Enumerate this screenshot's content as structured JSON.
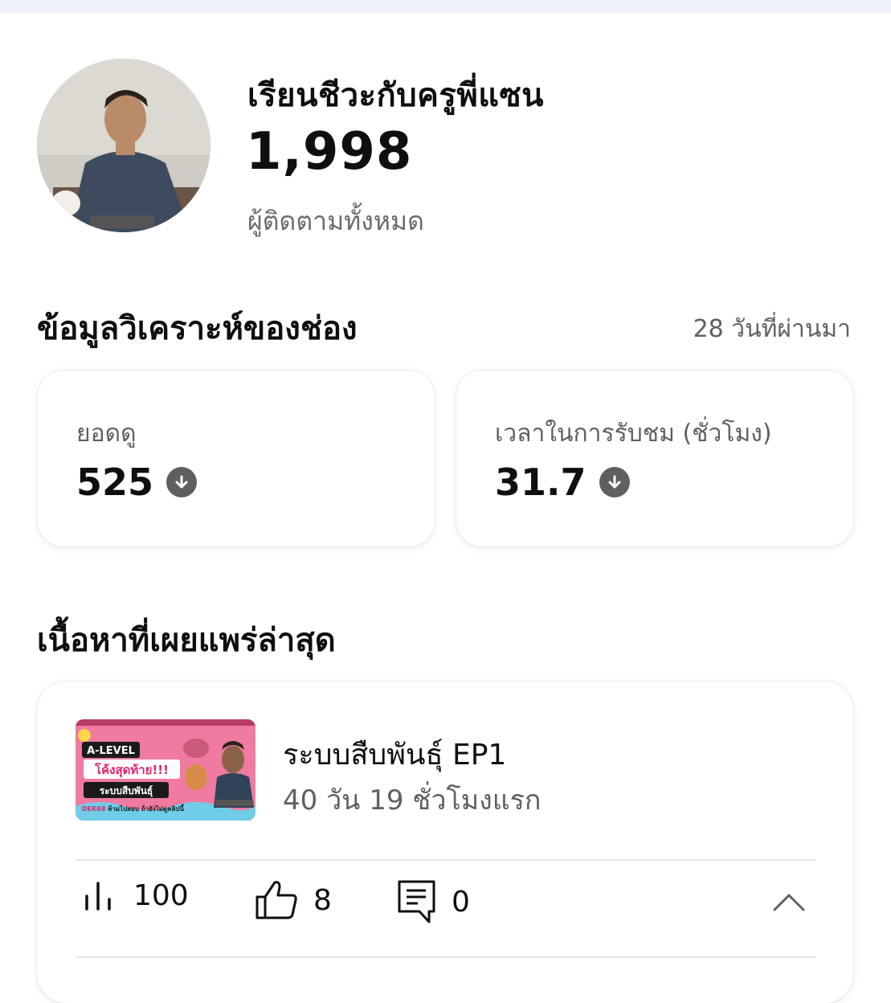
{
  "channel": {
    "name": "เรียนชีวะกับครูพี่แซน",
    "subscriber_count": "1,998",
    "subscriber_label": "ผู้ติดตามทั้งหมด"
  },
  "analytics": {
    "title": "ข้อมูลวิเคราะห์ของช่อง",
    "period": "28 วันที่ผ่านมา",
    "views": {
      "label": "ยอดดู",
      "value": "525",
      "trend_icon": "arrow-down-circle-icon"
    },
    "watch_time": {
      "label": "เวลาในการรับชม (ชั่วโมง)",
      "value": "31.7",
      "trend_icon": "arrow-down-circle-icon"
    }
  },
  "latest_content": {
    "title": "เนื้อหาที่เผยแพร่ล่าสุด",
    "video": {
      "title": "ระบบสืบพันธุ์ EP1",
      "age": "40 วัน 19 ชั่วโมงแรก",
      "thumbnail": {
        "line1": "A-LEVEL",
        "line2": "โค้งสุดท้าย!!!",
        "line3": "ระบบสืบพันธุ์",
        "line4_highlight": "DEK68",
        "line4": "ห้ามไปสอบ ถ้ายังไม่ดูคลิปนี้"
      },
      "metrics": {
        "views": "100",
        "likes": "8",
        "comments": "0"
      }
    }
  },
  "colors": {
    "text_primary": "#0f0f0f",
    "text_secondary": "#606060",
    "trend_down": "#5f5f5f",
    "thumbnail_bg": "#f07aa0"
  }
}
